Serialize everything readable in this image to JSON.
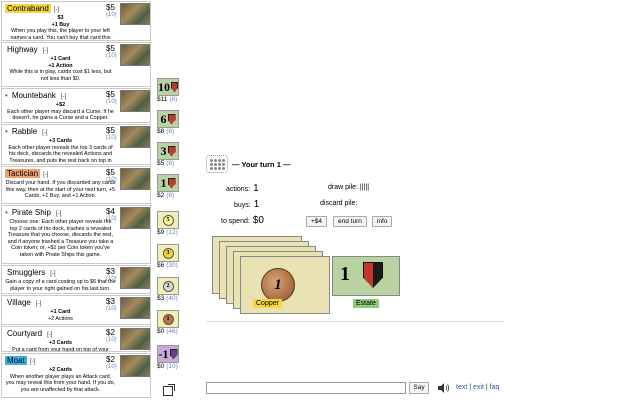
{
  "kingdom": [
    {
      "name": "Contraband",
      "hl": "#f5d742",
      "cp": "[-]",
      "cost": "$5",
      "count": "(10)",
      "lines": [
        "$3",
        "+1 Buy",
        "When you play this, the player to your left names a card. You can't buy that card this turn."
      ],
      "wide": true,
      "bullet": false
    },
    {
      "name": "Highway",
      "hl": "",
      "cp": "[-]",
      "cost": "$5",
      "count": "(10)",
      "lines": [
        "+1 Card",
        "+1 Action",
        "While this is in play, cards cost $1 less, but not less than $0."
      ],
      "wide": true,
      "bullet": false
    },
    {
      "name": "Mountebank",
      "hl": "",
      "cp": "[-]",
      "cost": "$5",
      "count": "(10)",
      "lines": [
        "+$2",
        "Each other player may discard a Curse. If he doesn't, he gains a Curse and a Copper."
      ],
      "wide": true,
      "bullet": true
    },
    {
      "name": "Rabble",
      "hl": "",
      "cp": "[-]",
      "cost": "$5",
      "count": "(10)",
      "lines": [
        "+3 Cards",
        "Each other player reveals the top 3 cards of his deck, discards the revealed Actions and Treasures, and puts the rest back on top in any order."
      ],
      "wide": true,
      "bullet": true
    },
    {
      "name": "Tactician",
      "hl": "#f0a070",
      "cp": "[-]",
      "cost": "$5",
      "count": "(10)",
      "lines": [
        "Discard your hand. If you discarded any cards this way, then at the start of your next turn, +5 Cards, +1 Buy, and +1 Action."
      ],
      "wide": false,
      "bullet": false
    },
    {
      "name": "Pirate Ship",
      "hl": "",
      "cp": "[-]",
      "cost": "$4",
      "count": "(10)",
      "lines": [
        "Choose one: Each other player reveals the top 2 cards of his deck, trashes a revealed Treasure that you choose, discards the rest, and if anyone trashed a Treasure you take a Coin token; or, +$1 per Coin token you've taken with Pirate Ships this game."
      ],
      "wide": false,
      "bullet": true
    },
    {
      "name": "Smugglers",
      "hl": "",
      "cp": "[-]",
      "cost": "$3",
      "count": "(10)",
      "lines": [
        "Gain a copy of a card costing up to $6 that the player to your right gained on his last turn."
      ],
      "wide": false,
      "bullet": false
    },
    {
      "name": "Village",
      "hl": "",
      "cp": "[-]",
      "cost": "$3",
      "count": "(10)",
      "lines": [
        "+1 Card",
        "+2 Actions"
      ],
      "wide": false,
      "bullet": false
    },
    {
      "name": "Courtyard",
      "hl": "",
      "cp": "[-]",
      "cost": "$2",
      "count": "(10)",
      "lines": [
        "+3 Cards",
        "Put a card from your hand on top of your deck."
      ],
      "wide": true,
      "bullet": false
    },
    {
      "name": "Moat",
      "hl": "#3cb0e0",
      "cp": "[-]",
      "cost": "$2",
      "count": "(10)",
      "lines": [
        "+2 Cards",
        "When another player plays an Attack card, you may reveal this from your hand. If you do, you are unaffected by that attack."
      ],
      "wide": true,
      "bullet": false
    }
  ],
  "supply": [
    {
      "face": "10",
      "kind": "victory",
      "bg": "#b8d2a2",
      "cost": "$11",
      "count": "(8)"
    },
    {
      "face": "6",
      "kind": "victory",
      "bg": "#b8d2a2",
      "cost": "$8",
      "count": "(8)"
    },
    {
      "face": "3",
      "kind": "victory",
      "bg": "#b8d2a2",
      "cost": "$5",
      "count": "(8)"
    },
    {
      "face": "1",
      "kind": "victory",
      "bg": "#b8d2a2",
      "cost": "$2",
      "count": "(8)"
    },
    {
      "face": "5",
      "kind": "coin",
      "bg": "#f3ecb6",
      "coinbg": "#fff6a0",
      "cost": "$9",
      "count": "(12)"
    },
    {
      "face": "3",
      "kind": "coin",
      "bg": "#f3ecb6",
      "coinbg": "#f0d43a",
      "cost": "$6",
      "count": "(30)"
    },
    {
      "face": "2",
      "kind": "coin",
      "bg": "#f3ecb6",
      "coinbg": "#d8d8d8",
      "cost": "$3",
      "count": "(40)"
    },
    {
      "face": "1",
      "kind": "coin",
      "bg": "#f3ecb6",
      "coinbg": "#b8774a",
      "cost": "$0",
      "count": "(46)"
    },
    {
      "face": "-1",
      "kind": "curse",
      "bg": "#c9a9d8",
      "cost": "$0",
      "count": "(10)"
    }
  ],
  "turn": {
    "title": "— Your turn 1 —"
  },
  "stats": {
    "actions_label": "actions:",
    "actions": "1",
    "buys_label": "buys:",
    "buys": "1",
    "spend_label": "to spend:",
    "spend": "$0",
    "draw_label": "draw pile:",
    "draw": "|||||",
    "discard_label": "discard pile:"
  },
  "buttons": {
    "plus4": "+$4",
    "end_turn": "end turn",
    "info": "info"
  },
  "hand": {
    "copper_label": "Copper",
    "copper_face": "1",
    "copper_color": "#f5d742",
    "estate_label": "Estate",
    "estate_face": "1",
    "estate_color": "#8ccc78"
  },
  "chat": {
    "say": "Say"
  },
  "links": {
    "text": "text",
    "sep1": "|",
    "exit": "exit",
    "sep2": "|",
    "faq": "faq"
  }
}
